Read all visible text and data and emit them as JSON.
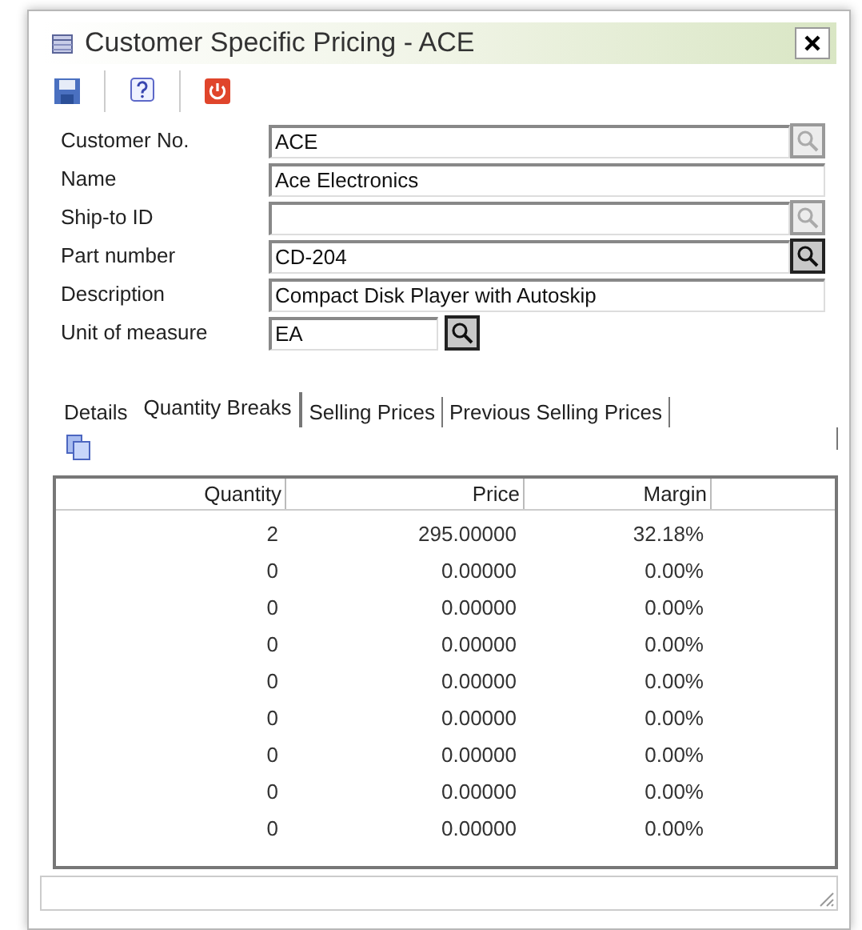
{
  "window": {
    "title": "Customer Specific Pricing - ACE"
  },
  "fields": [
    {
      "label": "Customer No.",
      "value": "ACE",
      "lookup": {
        "disabled": true
      },
      "kind": "wide"
    },
    {
      "label": "Name",
      "value": "Ace Electronics",
      "kind": "wide"
    },
    {
      "label": "Ship-to ID",
      "lookup": {
        "disabled": true
      },
      "kind": "wide"
    },
    {
      "label": "Part number",
      "value": "CD-204",
      "lookup": {
        "disabled": false
      },
      "kind": "wide"
    },
    {
      "label": "Description",
      "value": "Compact Disk Player with Autoskip",
      "kind": "wide"
    },
    {
      "label": "Unit of measure",
      "value": "EA",
      "lookup": {
        "disabled": false
      },
      "kind": "short"
    }
  ],
  "tabs": [
    {
      "label": "Details",
      "selected": false
    },
    {
      "label": "Quantity Breaks",
      "selected": true
    },
    {
      "label": "Selling Prices",
      "selected": false
    },
    {
      "label": "Previous Selling Prices",
      "selected": false
    }
  ],
  "table": {
    "columns": [
      "Quantity",
      "Price",
      "Margin"
    ],
    "rows": [
      [
        "2",
        "295.00000",
        "32.18%"
      ],
      [
        "0",
        "0.00000",
        "0.00%"
      ],
      [
        "0",
        "0.00000",
        "0.00%"
      ],
      [
        "0",
        "0.00000",
        "0.00%"
      ],
      [
        "0",
        "0.00000",
        "0.00%"
      ],
      [
        "0",
        "0.00000",
        "0.00%"
      ],
      [
        "0",
        "0.00000",
        "0.00%"
      ],
      [
        "0",
        "0.00000",
        "0.00%"
      ],
      [
        "0",
        "0.00000",
        "0.00%"
      ]
    ]
  }
}
